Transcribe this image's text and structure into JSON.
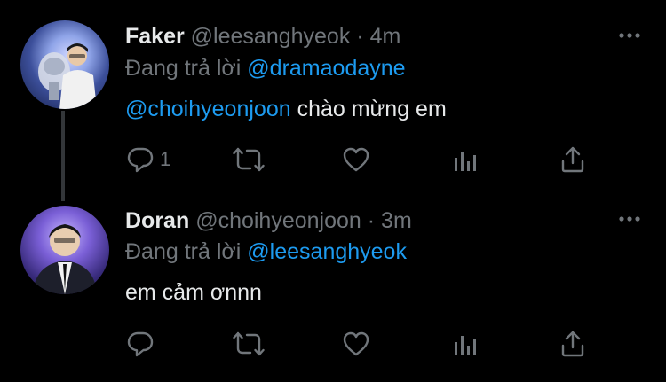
{
  "tweets": [
    {
      "name": "Faker",
      "handle": "@leesanghyeok",
      "separator": "·",
      "time": "4m",
      "replying_prefix": "Đang trả lời",
      "replying_to": "@dramaodayne",
      "mention": "@choihyeonjoon",
      "text": "chào mừng em",
      "reply_count": "1",
      "avatar_icon": "faker-avatar-photo"
    },
    {
      "name": "Doran",
      "handle": "@choihyeonjoon",
      "separator": "·",
      "time": "3m",
      "replying_prefix": "Đang trả lời",
      "replying_to": "@leesanghyeok",
      "text": "em cảm ơnnn",
      "avatar_icon": "doran-avatar-photo"
    }
  ],
  "colors": {
    "background": "#000000",
    "text": "#e7e9ea",
    "muted": "#71767b",
    "link": "#1d9bf0",
    "thread_line": "#333639"
  }
}
